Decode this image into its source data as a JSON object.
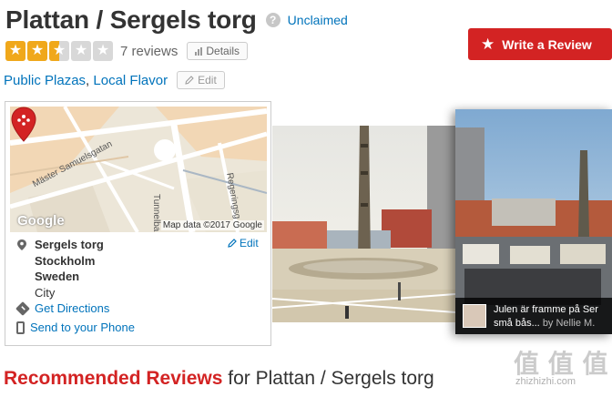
{
  "business": {
    "name": "Plattan / Sergels torg",
    "claim_status": "Unclaimed",
    "rating": 2.5,
    "rating_max": 5,
    "review_count_text": "7 reviews",
    "details_label": "Details",
    "categories": [
      "Public Plazas",
      "Local Flavor"
    ],
    "category_separator": ",",
    "edit_label": "Edit"
  },
  "actions": {
    "write_review_label": "Write a Review"
  },
  "map": {
    "streets": [
      "Mäster Samuelsgatan",
      "Tunnelbana",
      "Regeringsg"
    ],
    "google_logo": "Google",
    "attribution": "Map data ©2017 Google"
  },
  "address": {
    "lines": [
      "Sergels torg",
      "Stockholm",
      "Sweden"
    ],
    "area": "City",
    "edit_label": "Edit"
  },
  "links": {
    "directions": "Get Directions",
    "phone": "Send to your Phone"
  },
  "photo_caption": {
    "line1": "Julen är framme på Ser",
    "line2_text": "små bås...",
    "line2_by": "by Nellie M."
  },
  "reviews": {
    "heading_highlight": "Recommended Reviews",
    "heading_rest": "for Plattan / Sergels torg"
  },
  "watermark": {
    "main": "值 值 值",
    "sub": "zhizhizhi.com"
  },
  "colors": {
    "brand_red": "#d32323",
    "link_blue": "#0073bb",
    "star_orange": "#f0a81b",
    "star_empty": "#d8d8d8"
  },
  "icons": {
    "info": "info-icon",
    "details": "bar-chart-icon",
    "edit": "pencil-icon",
    "write_review": "star-icon",
    "address": "map-pin-icon",
    "directions": "directions-icon",
    "phone": "phone-icon"
  }
}
